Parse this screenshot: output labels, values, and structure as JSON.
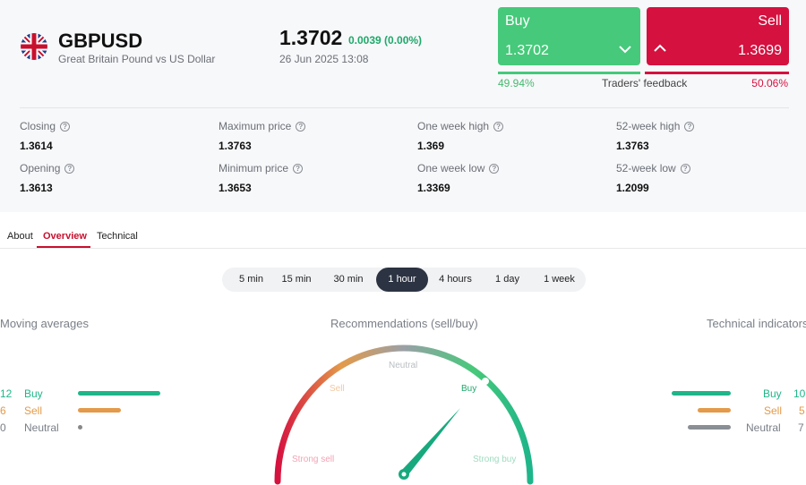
{
  "instrument": {
    "symbol": "GBPUSD",
    "description": "Great Britain Pound vs US Dollar",
    "price": "1.3702",
    "change": "0.0039 (0.00%)",
    "timestamp": "26 Jun 2025 13:08"
  },
  "trade": {
    "buy_label": "Buy",
    "buy_price": "1.3702",
    "sell_label": "Sell",
    "sell_price": "1.3699"
  },
  "feedback": {
    "buy_pct": "49.94%",
    "label": "Traders' feedback",
    "sell_pct": "50.06%",
    "buy_fraction": 0.4994
  },
  "stats": [
    {
      "label": "Closing",
      "value": "1.3614"
    },
    {
      "label": "Maximum price",
      "value": "1.3763"
    },
    {
      "label": "One week high",
      "value": "1.369"
    },
    {
      "label": "52-week high",
      "value": "1.3763"
    },
    {
      "label": "Opening",
      "value": "1.3613"
    },
    {
      "label": "Minimum price",
      "value": "1.3653"
    },
    {
      "label": "One week low",
      "value": "1.3369"
    },
    {
      "label": "52-week low",
      "value": "1.2099"
    }
  ],
  "tabs": [
    {
      "label": "About"
    },
    {
      "label": "Overview"
    },
    {
      "label": "Technical"
    }
  ],
  "active_tab": "Overview",
  "periods": [
    "5 min",
    "15 min",
    "30 min",
    "1 hour",
    "4 hours",
    "1 day",
    "1 week"
  ],
  "active_period": "1 hour",
  "moving_averages": {
    "title": "Moving averages",
    "buy_count": "12",
    "buy_label": "Buy",
    "sell_count": "6",
    "sell_label": "Sell",
    "neutral_count": "0",
    "neutral_label": "Neutral"
  },
  "recommendations": {
    "title": "Recommendations (sell/buy)",
    "labels": {
      "strong_sell": "Strong sell",
      "sell": "Sell",
      "neutral": "Neutral",
      "buy": "Buy",
      "strong_buy": "Strong buy"
    },
    "needle_level": "Buy"
  },
  "technical_indicators": {
    "title": "Technical indicators",
    "buy_count": "10",
    "buy_label": "Buy",
    "sell_count": "5",
    "sell_label": "Sell",
    "neutral_count": "7",
    "neutral_label": "Neutral"
  },
  "colors": {
    "buy": "#46c97a",
    "sell": "#d5113f",
    "accent": "#c8102e",
    "ma_buy": "#1fb58a",
    "ma_sell": "#e39a4a",
    "neutral": "#8a8e95"
  },
  "icons": {
    "flag": "uk-flag-icon",
    "info": "info-icon",
    "buy_chevron": "chevron-down-icon",
    "sell_chevron": "chevron-up-icon"
  }
}
